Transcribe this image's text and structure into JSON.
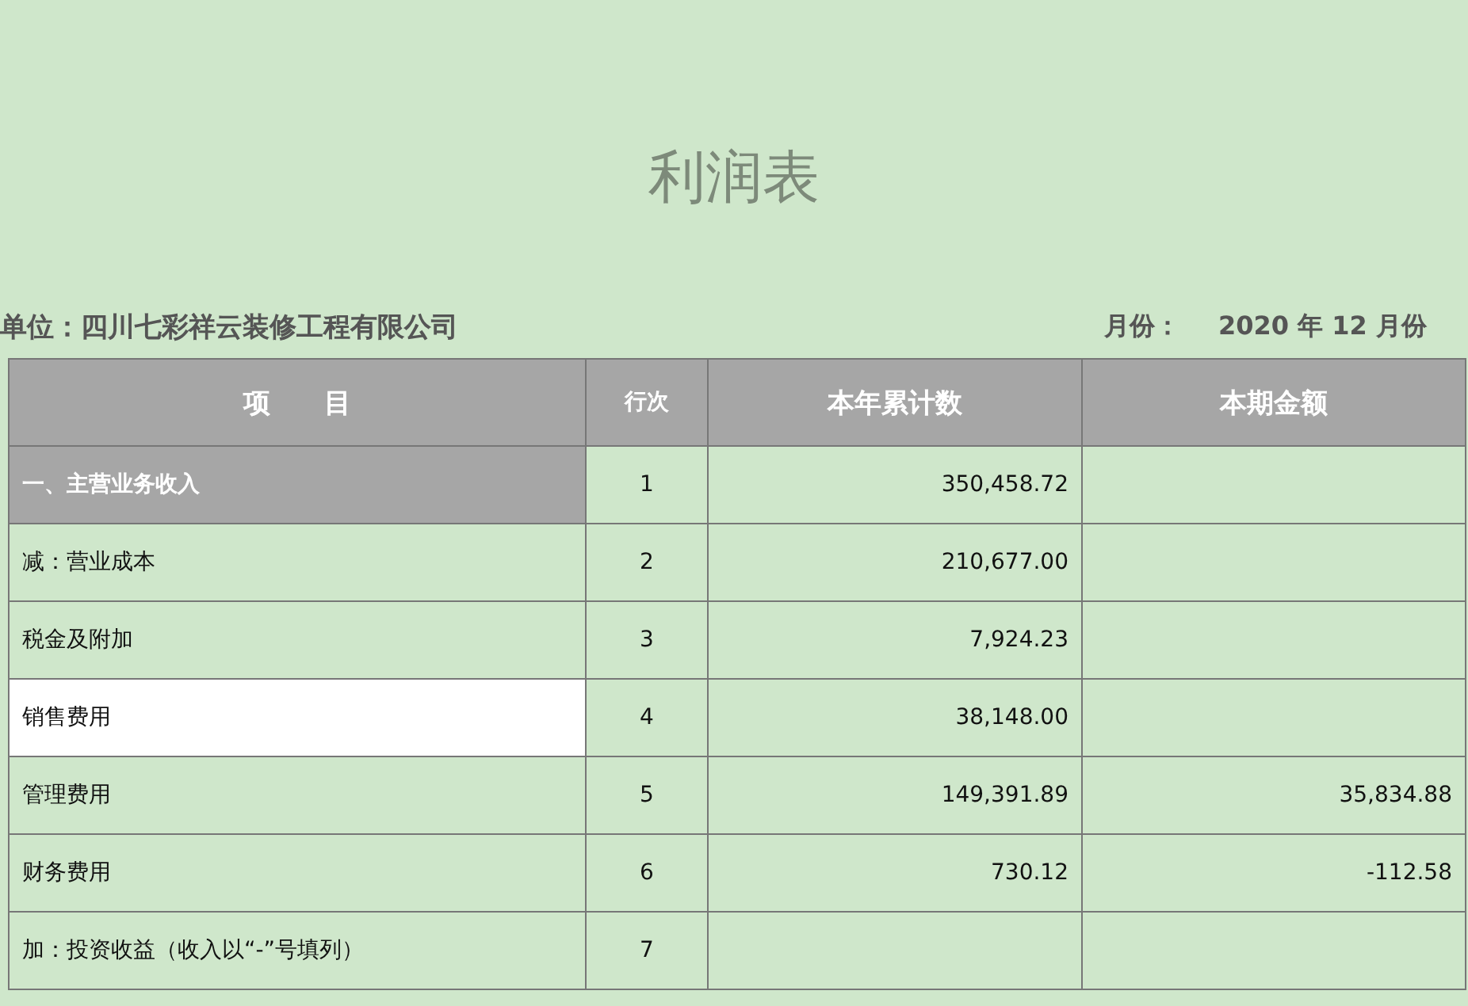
{
  "title": "利润表",
  "unit": "单位：四川七彩祥云装修工程有限公司",
  "month_label": "月份：",
  "month_value": "2020 年 12 月份",
  "table": {
    "columns": [
      "项　　目",
      "行次",
      "本年累计数",
      "本期金额"
    ],
    "rows": [
      {
        "kind": "section",
        "item": "一、主营业务收入",
        "line": "1",
        "ytd": "350,458.72",
        "period": "",
        "selected": false
      },
      {
        "kind": "line",
        "item": "减：营业成本",
        "line": "2",
        "ytd": "210,677.00",
        "period": "",
        "selected": false
      },
      {
        "kind": "line",
        "item": "税金及附加",
        "line": "3",
        "ytd": "7,924.23",
        "period": "",
        "selected": false
      },
      {
        "kind": "line",
        "item": "销售费用",
        "line": "4",
        "ytd": "38,148.00",
        "period": "",
        "selected": true
      },
      {
        "kind": "line",
        "item": "管理费用",
        "line": "5",
        "ytd": "149,391.89",
        "period": "35,834.88",
        "selected": false
      },
      {
        "kind": "line",
        "item": "财务费用",
        "line": "6",
        "ytd": "730.12",
        "period": "-112.58",
        "selected": false
      },
      {
        "kind": "line",
        "item": "加：投资收益（收入以“-”号填列）",
        "line": "7",
        "ytd": "",
        "period": "",
        "selected": false
      }
    ]
  }
}
